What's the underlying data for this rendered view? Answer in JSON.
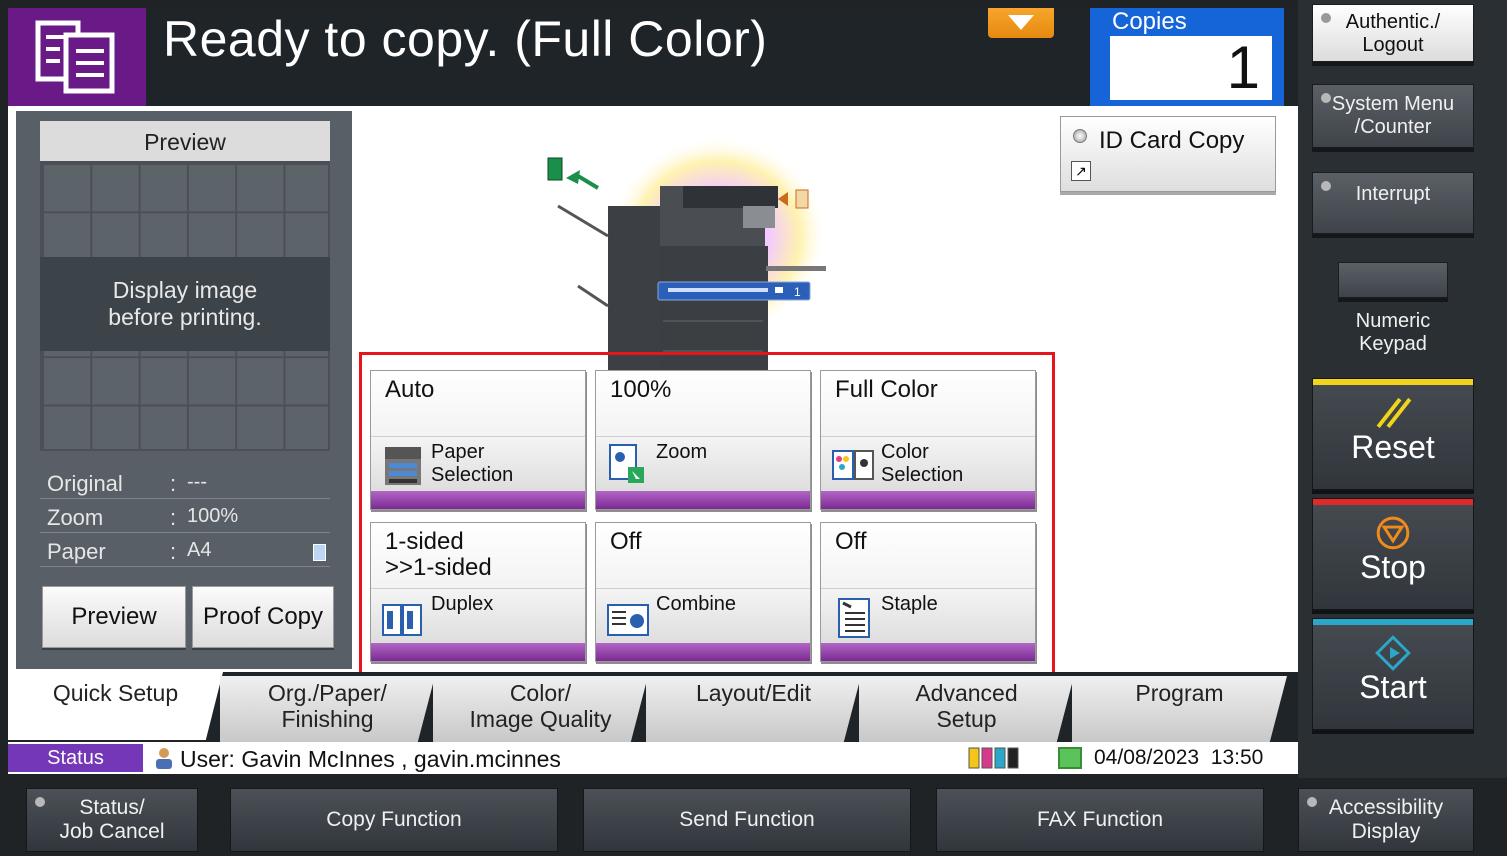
{
  "header": {
    "title": "Ready to copy. (Full Color)",
    "copies_label": "Copies",
    "copies_value": "1"
  },
  "preview": {
    "title": "Preview",
    "message_line1": "Display image",
    "message_line2": "before printing.",
    "info": [
      {
        "label": "Original",
        "sep": ":",
        "value": "---"
      },
      {
        "label": "Zoom",
        "sep": ":",
        "value": "100%"
      },
      {
        "label": "Paper",
        "sep": ":",
        "value": "A4"
      }
    ],
    "preview_button": "Preview",
    "proof_copy_button": "Proof Copy"
  },
  "id_card_copy": "ID Card Copy",
  "functions": [
    {
      "value": "Auto",
      "name": "Paper\nSelection",
      "icon": "paper-selection-icon"
    },
    {
      "value": "100%",
      "name": "Zoom",
      "icon": "zoom-icon"
    },
    {
      "value": "Full Color",
      "name": "Color\nSelection",
      "icon": "color-selection-icon"
    },
    {
      "value": "1-sided\n>>1-sided",
      "name": "Duplex",
      "icon": "duplex-icon"
    },
    {
      "value": "Off",
      "name": "Combine",
      "icon": "combine-icon"
    },
    {
      "value": "Off",
      "name": "Staple",
      "icon": "staple-icon"
    }
  ],
  "tabs": [
    {
      "label": "Quick Setup",
      "active": true
    },
    {
      "label": "Org./Paper/\nFinishing"
    },
    {
      "label": "Color/\nImage Quality"
    },
    {
      "label": "Layout/Edit"
    },
    {
      "label": "Advanced\nSetup"
    },
    {
      "label": "Program"
    }
  ],
  "status": {
    "badge": "Status",
    "user": "User: Gavin McInnes , gavin.mcinnes",
    "date": "04/08/2023",
    "time": "13:50"
  },
  "side_keys": {
    "authentic": "Authentic./\nLogout",
    "system_menu": "System Menu\n/Counter",
    "interrupt": "Interrupt",
    "numeric_keypad": "Numeric\nKeypad",
    "reset": "Reset",
    "stop": "Stop",
    "start": "Start"
  },
  "bottom_keys": {
    "status_job_cancel": "Status/\nJob Cancel",
    "copy_function": "Copy Function",
    "send_function": "Send Function",
    "fax_function": "FAX Function",
    "accessibility": "Accessibility\nDisplay"
  },
  "colors": {
    "accent_purple": "#7b2a93",
    "copies_blue": "#1565d8",
    "highlight_red": "#e8141b",
    "reset_yellow": "#f2d51a",
    "stop_red": "#e02a2a",
    "start_teal": "#2aa7c9"
  }
}
